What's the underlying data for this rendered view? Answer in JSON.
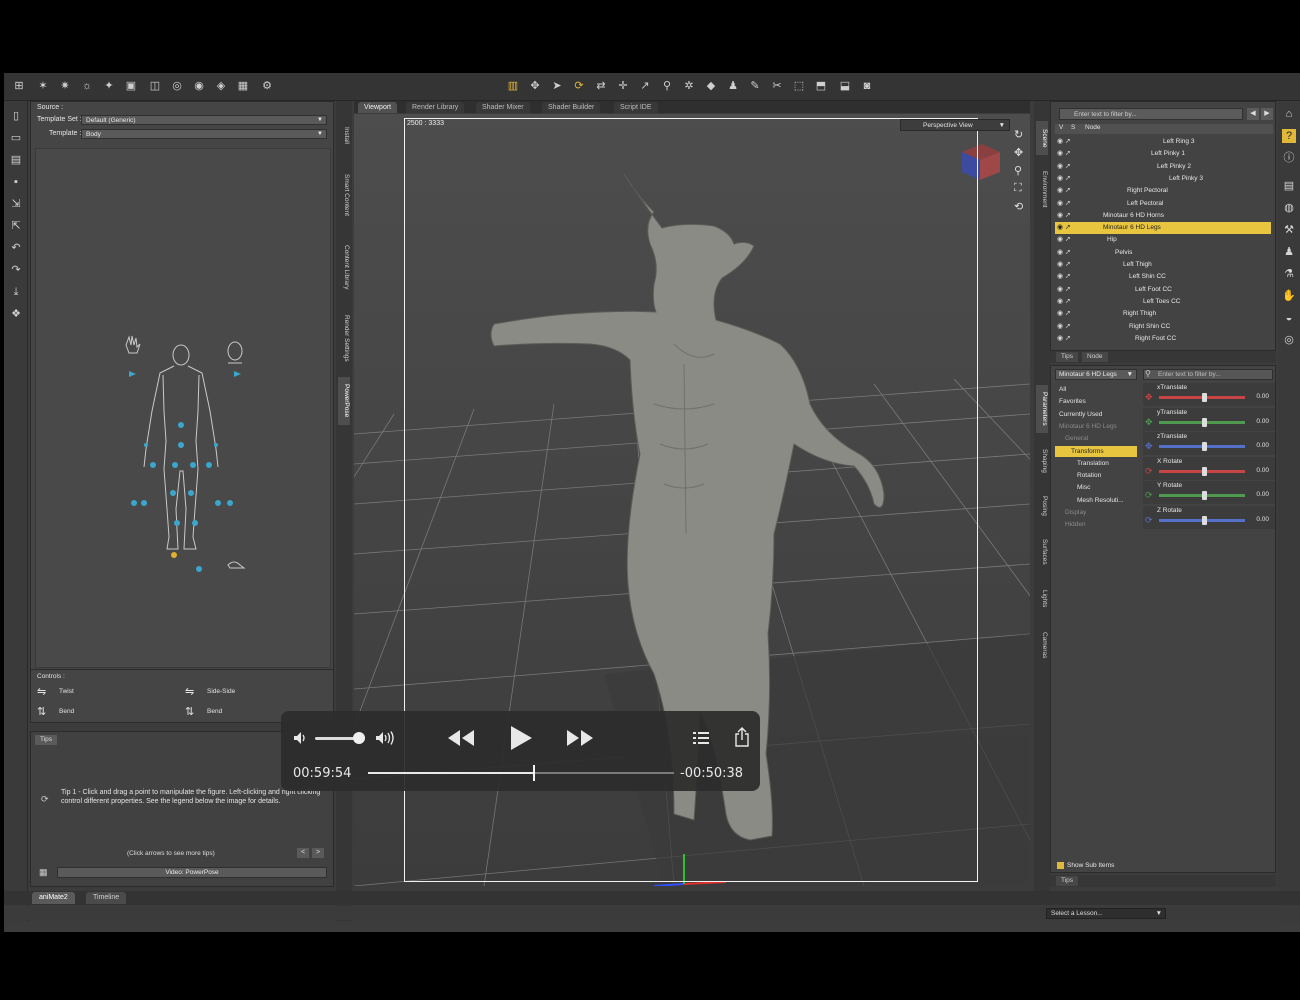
{
  "viewport": {
    "tabs": [
      "Viewport",
      "Render Library",
      "Shader Mixer",
      "Shader Builder",
      "Script IDE"
    ],
    "resolution": "2500 : 3333",
    "view": "Perspective View"
  },
  "left_vtabs": [
    "Install",
    "Smart Content",
    "Content Library",
    "Render Settings",
    "PowerPose"
  ],
  "pose_panel": {
    "source_label": "Source :",
    "template_set_label": "Template Set :",
    "template_set_value": "Default (Generic)",
    "template_label": "Template :",
    "template_value": "Body"
  },
  "controls": {
    "title": "Controls :",
    "items": [
      "Twist",
      "Side-Side",
      "Bend",
      "Bend"
    ]
  },
  "tips": {
    "tab": "Tips",
    "text": "Tip 1 - Click and drag a point to manipulate the figure. Left-clicking and right clicking control different properties. See the legend below the image for details.",
    "nav": "(Click arrows to see more tips)",
    "video_button": "Video: PowerPose"
  },
  "scene": {
    "filter_placeholder": "Enter text to filter by...",
    "col_v": "V",
    "col_s": "S",
    "col_node": "Node",
    "nodes": [
      {
        "label": "Left Ring 3",
        "indent": 108,
        "selected": false
      },
      {
        "label": "Left Pinky 1",
        "indent": 96,
        "selected": false
      },
      {
        "label": "Left Pinky 2",
        "indent": 102,
        "selected": false
      },
      {
        "label": "Left Pinky 3",
        "indent": 114,
        "selected": false
      },
      {
        "label": "Right Pectoral",
        "indent": 72,
        "selected": false
      },
      {
        "label": "Left Pectoral",
        "indent": 72,
        "selected": false
      },
      {
        "label": "Minotaur 6 HD Horns",
        "indent": 48,
        "selected": false
      },
      {
        "label": "Minotaur 6 HD Legs",
        "indent": 48,
        "selected": true
      },
      {
        "label": "Hip",
        "indent": 52,
        "selected": false
      },
      {
        "label": "Pelvis",
        "indent": 60,
        "selected": false
      },
      {
        "label": "Left Thigh",
        "indent": 68,
        "selected": false
      },
      {
        "label": "Left Shin CC",
        "indent": 74,
        "selected": false
      },
      {
        "label": "Left Foot CC",
        "indent": 80,
        "selected": false
      },
      {
        "label": "Left Toes CC",
        "indent": 88,
        "selected": false
      },
      {
        "label": "Right Thigh",
        "indent": 68,
        "selected": false
      },
      {
        "label": "Right Shin CC",
        "indent": 74,
        "selected": false
      },
      {
        "label": "Right Foot CC",
        "indent": 80,
        "selected": false
      }
    ],
    "tabs": [
      "Tips",
      "Node"
    ]
  },
  "right_vtabs_top": [
    "Scene",
    "Environment"
  ],
  "right_vtabs_bottom": [
    "Parameters",
    "Shaping",
    "Posing",
    "Surfaces",
    "Lights",
    "Cameras"
  ],
  "parameters": {
    "dropdown": "Minotaur 6 HD Legs",
    "filter_placeholder": "Enter text to filter by...",
    "list": [
      {
        "label": "All",
        "state": ""
      },
      {
        "label": "Favorites",
        "state": ""
      },
      {
        "label": "Currently Used",
        "state": ""
      },
      {
        "label": "Minotaur 6 HD Legs",
        "state": "dim"
      },
      {
        "label": "General",
        "state": "dim"
      },
      {
        "label": "Transforms",
        "state": "sel"
      },
      {
        "label": "Translation",
        "state": ""
      },
      {
        "label": "Rotation",
        "state": ""
      },
      {
        "label": "Misc",
        "state": ""
      },
      {
        "label": "Mesh Resoluti...",
        "state": ""
      },
      {
        "label": "Display",
        "state": "dim"
      },
      {
        "label": "Hidden",
        "state": "dim"
      }
    ],
    "sliders": [
      {
        "name": "xTranslate",
        "value": "0.00",
        "color": "#c84545"
      },
      {
        "name": "yTranslate",
        "value": "0.00",
        "color": "#4f9a4f"
      },
      {
        "name": "zTranslate",
        "value": "0.00",
        "color": "#5570c8"
      },
      {
        "name": "X Rotate",
        "value": "0.00",
        "color": "#c84545"
      },
      {
        "name": "Y Rotate",
        "value": "0.00",
        "color": "#4f9a4f"
      },
      {
        "name": "Z Rotate",
        "value": "0.00",
        "color": "#5570c8"
      }
    ],
    "show_sub": "Show Sub Items",
    "tips_tab": "Tips"
  },
  "bottom": {
    "tabs": [
      "aniMate2",
      "Timeline"
    ],
    "lesson": "Select a Lesson..."
  },
  "player": {
    "elapsed": "00:59:54",
    "remaining": "-00:50:38",
    "progress": 0.542,
    "volume": 0.88
  },
  "colors": {
    "accent": "#e8c53f"
  }
}
